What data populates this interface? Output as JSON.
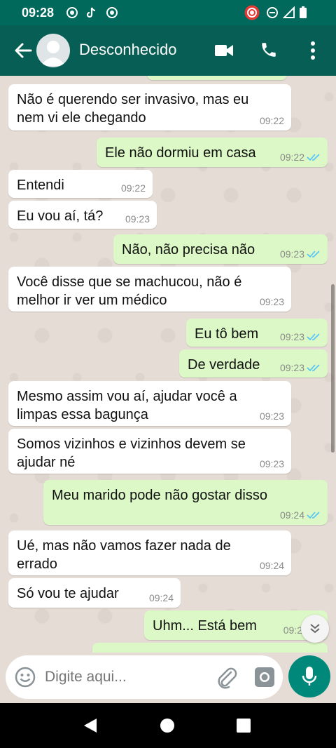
{
  "status_bar": {
    "time": "09:28"
  },
  "header": {
    "contact_name": "Desconhecido"
  },
  "messages": [
    {
      "dir": "in",
      "text": "Não é querendo ser invasivo, mas eu\nnem vi ele chegando",
      "time": "09:22"
    },
    {
      "dir": "out",
      "text": "Ele não dormiu em casa",
      "time": "09:22"
    },
    {
      "dir": "in",
      "text": "Entendi",
      "time": "09:22"
    },
    {
      "dir": "in",
      "text": "Eu vou aí, tá?",
      "time": "09:23"
    },
    {
      "dir": "out",
      "text": "Não, não precisa não",
      "time": "09:23"
    },
    {
      "dir": "in",
      "text": "Você disse que se machucou, não é\nmelhor ir ver um médico",
      "time": "09:23"
    },
    {
      "dir": "out",
      "text": "Eu tô bem",
      "time": "09:23"
    },
    {
      "dir": "out",
      "text": "De verdade",
      "time": "09:23"
    },
    {
      "dir": "in",
      "text": "Mesmo assim vou aí, ajudar você a\nlimpas essa bagunça",
      "time": "09:23"
    },
    {
      "dir": "in",
      "text": "Somos vizinhos e vizinhos devem se\najudar né",
      "time": "09:23"
    },
    {
      "dir": "out",
      "text": "Meu marido pode não gostar disso",
      "time": "09:24"
    },
    {
      "dir": "in",
      "text": "Ué, mas não vamos fazer nada de\nerrado",
      "time": "09:24"
    },
    {
      "dir": "in",
      "text": "Só vou te ajudar",
      "time": "09:24"
    },
    {
      "dir": "out",
      "text": "Uhm... Está bem",
      "time": "09:2"
    }
  ],
  "composer": {
    "placeholder": "Digite aqui..."
  },
  "colors": {
    "header": "#075e54",
    "status_bar": "#00695c",
    "outgoing_bubble": "#dcf8c6",
    "incoming_bubble": "#ffffff",
    "accent": "#00897b",
    "read_ticks": "#4fc3f7"
  }
}
